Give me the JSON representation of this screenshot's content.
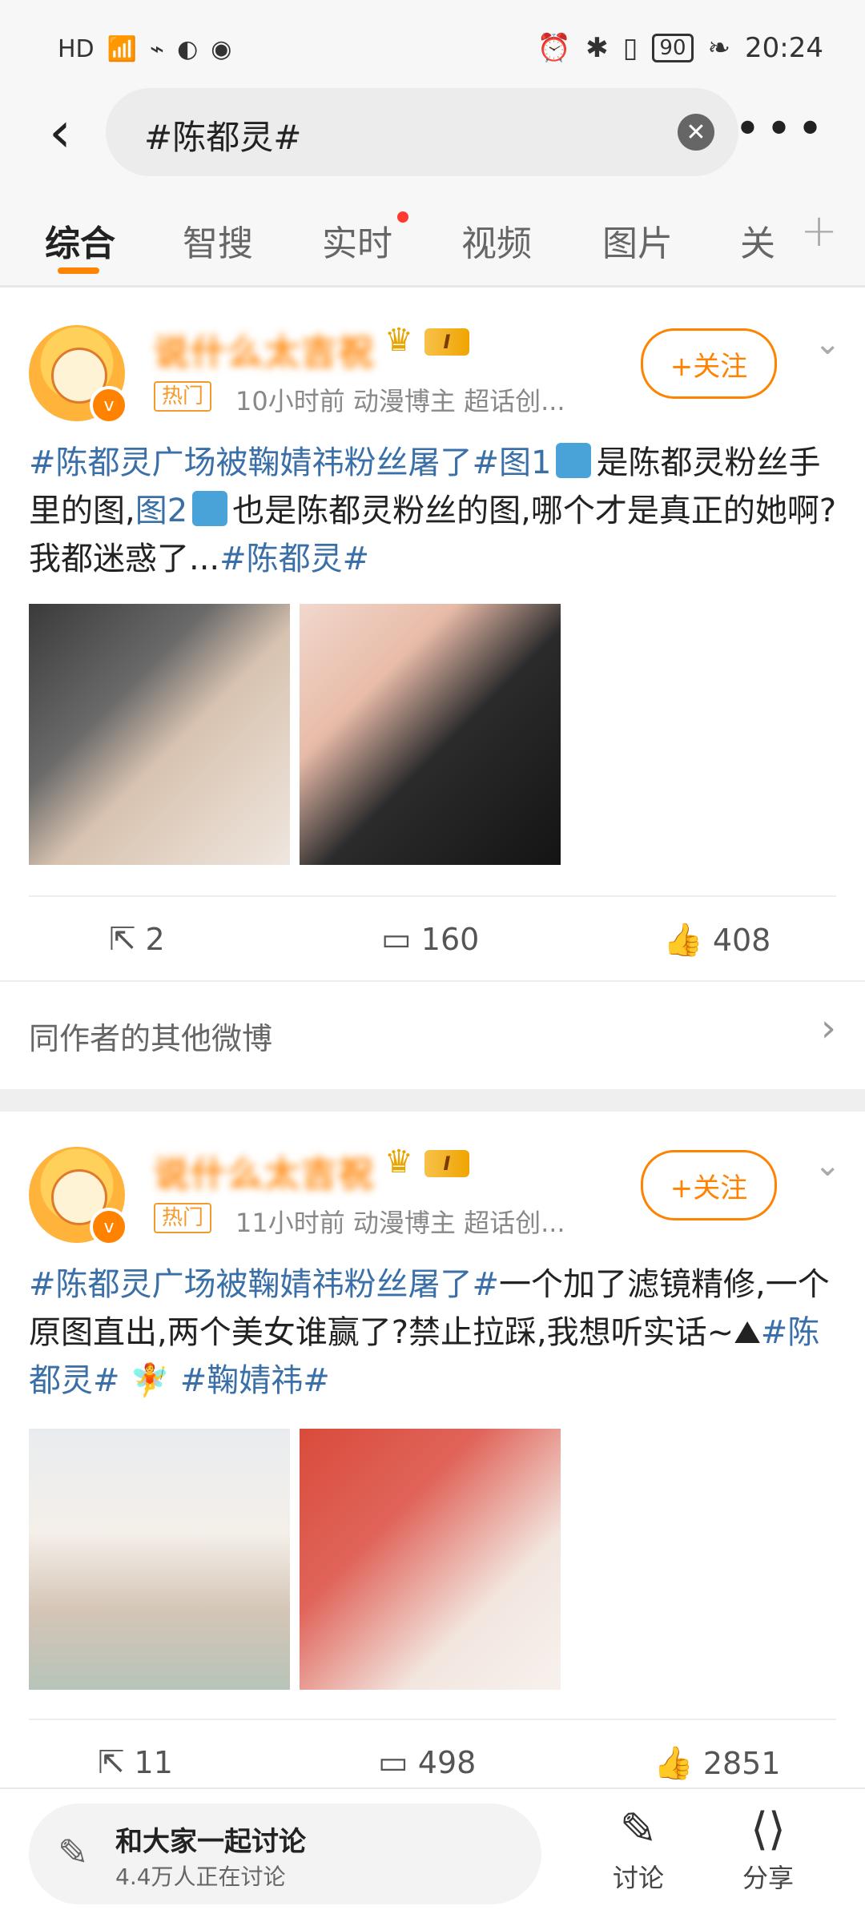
{
  "status_bar": {
    "left_icons": [
      "HD",
      "4G",
      "signal-icon",
      "wifi-icon",
      "wechat-icon",
      "weibo-icon"
    ],
    "battery": "90",
    "time": "20:24"
  },
  "search": {
    "query": "#陈都灵#"
  },
  "tabs": [
    {
      "label": "综合",
      "active": true
    },
    {
      "label": "智搜"
    },
    {
      "label": "实时",
      "dot": true
    },
    {
      "label": "视频"
    },
    {
      "label": "图片"
    },
    {
      "label": "关"
    }
  ],
  "posts": [
    {
      "username": "说什么太吉祝",
      "hot_label": "热门",
      "meta": "10小时前   动漫博主 超话创...",
      "follow_label": "+关注",
      "text_topic": "#陈都灵广场被鞠婧祎粉丝屠了#",
      "text_a": "图1",
      "text_b": "是陈都灵粉丝手里的图,",
      "text_c": "图2",
      "text_d": "也是陈都灵粉丝的图,哪个才是真正的她啊?我都迷惑了...",
      "text_topic2": "#陈都灵#",
      "reposts": "2",
      "comments": "160",
      "likes": "408",
      "same_author_label": "同作者的其他微博"
    },
    {
      "username": "说什么太吉祝",
      "hot_label": "热门",
      "meta": "11小时前   动漫博主 超话创...",
      "follow_label": "+关注",
      "text_topic": "#陈都灵广场被鞠婧祎粉丝屠了#",
      "text_a": "一个加了滤镜精修,一个原图直出,两个美女谁赢了?禁止拉踩,我想听实话~",
      "text_topic2": "#陈都灵#",
      "text_topic3": "#鞠婧祎#",
      "reposts": "11",
      "comments": "498",
      "likes": "2851"
    }
  ],
  "bottom_bar": {
    "discuss_title": "和大家一起讨论",
    "discuss_sub": "4.4万人正在讨论",
    "discuss_btn": "讨论",
    "share_btn": "分享"
  },
  "colors": {
    "accent": "#ff8200",
    "topic": "#3a6fa7"
  }
}
